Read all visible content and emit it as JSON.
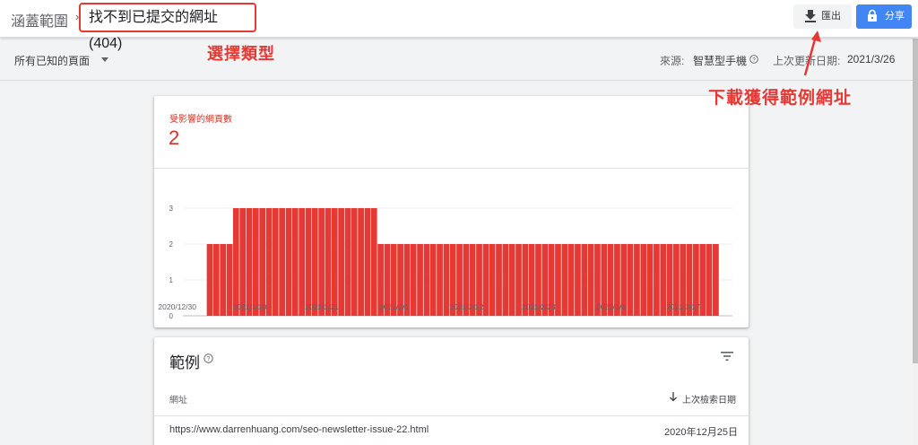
{
  "header": {
    "breadcrumb_root": "涵蓋範圍",
    "breadcrumb_separator": "›",
    "page_title": "找不到已提交的網址 (404)",
    "export_label": "匯出",
    "share_label": "分享",
    "export_icon": "download-icon",
    "share_icon": "lock-icon"
  },
  "filter": {
    "selected": "所有已知的頁面",
    "source_label": "來源:",
    "source_value": "智慧型手機",
    "updated_label": "上次更新日期:",
    "updated_value": "2021/3/26"
  },
  "annotations": {
    "choose_type": "選擇類型",
    "download_examples": "下載獲得範例網址"
  },
  "metric": {
    "label": "受影響的網頁數",
    "value": "2"
  },
  "chart_data": {
    "type": "bar",
    "ylim": [
      0,
      3
    ],
    "yticks": [
      "0",
      "1",
      "2",
      "3"
    ],
    "xtick_labels": [
      "2020/12/30",
      "2021/1/10",
      "2021/1/21",
      "2021/2/1",
      "2021/2/12",
      "2021/2/23",
      "2021/3/6",
      "2021/3/17"
    ],
    "start_date": "2020/12/30",
    "values": [
      0,
      0,
      0,
      0,
      0,
      2,
      2,
      2,
      2,
      3,
      3,
      3,
      3,
      3,
      3,
      3,
      3,
      3,
      3,
      3,
      3,
      3,
      3,
      3,
      3,
      3,
      3,
      3,
      3,
      3,
      3,
      2,
      2,
      2,
      2,
      2,
      2,
      2,
      2,
      2,
      2,
      2,
      2,
      2,
      2,
      2,
      2,
      2,
      2,
      2,
      2,
      2,
      2,
      2,
      2,
      2,
      2,
      2,
      2,
      2,
      2,
      2,
      2,
      2,
      2,
      2,
      2,
      2,
      2,
      2,
      2,
      2,
      2,
      2,
      2,
      2,
      2,
      2,
      2,
      2,
      2,
      2,
      2,
      0,
      0
    ],
    "bar_color": "#e53935",
    "grid": true
  },
  "examples": {
    "title": "範例",
    "col_url": "網址",
    "col_date": "上次檢索日期",
    "rows": [
      {
        "url": "https://www.darrenhuang.com/seo-newsletter-issue-22.html",
        "date": "2020年12月25日"
      }
    ]
  },
  "colors": {
    "accent_red": "#e53935",
    "share_blue": "#4285f4"
  }
}
